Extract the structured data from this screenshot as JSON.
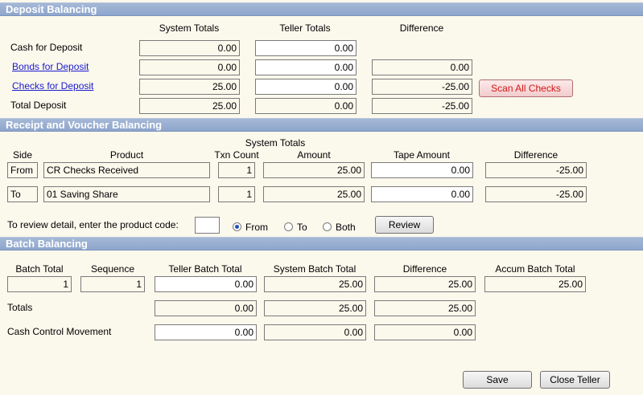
{
  "deposit": {
    "title": "Deposit Balancing",
    "headers": {
      "system": "System Totals",
      "teller": "Teller Totals",
      "diff": "Difference"
    },
    "rows": [
      {
        "label": "Cash for Deposit",
        "system": "0.00",
        "teller": "0.00",
        "diff": ""
      },
      {
        "label": "Bonds for Deposit",
        "system": "0.00",
        "teller": "0.00",
        "diff": "0.00"
      },
      {
        "label": "Checks for Deposit",
        "system": "25.00",
        "teller": "0.00",
        "diff": "-25.00"
      },
      {
        "label": "Total Deposit",
        "system": "25.00",
        "teller": "0.00",
        "diff": "-25.00"
      }
    ],
    "scan_button": "Scan All Checks"
  },
  "receipt": {
    "title": "Receipt and Voucher Balancing",
    "headers": {
      "system_totals": "System Totals",
      "side": "Side",
      "product": "Product",
      "txn_count": "Txn Count",
      "amount": "Amount",
      "tape_amount": "Tape Amount",
      "diff": "Difference"
    },
    "rows": [
      {
        "side": "From",
        "product": "CR Checks Received",
        "count": "1",
        "amount": "25.00",
        "tape": "0.00",
        "diff": "-25.00"
      },
      {
        "side": "To",
        "product": "01 Saving Share",
        "count": "1",
        "amount": "25.00",
        "tape": "0.00",
        "diff": "-25.00"
      }
    ],
    "review_prompt": "To review detail, enter the product code:",
    "product_code": "",
    "radio_from": "From",
    "radio_to": "To",
    "radio_both": "Both",
    "selected": "From",
    "review_button": "Review"
  },
  "batch": {
    "title": "Batch Balancing",
    "headers": {
      "batch_total": "Batch Total",
      "sequence": "Sequence",
      "teller_batch": "Teller Batch Total",
      "system_batch": "System Batch Total",
      "diff": "Difference",
      "accum": "Accum Batch Total"
    },
    "row": {
      "batch_total": "1",
      "sequence": "1",
      "teller_batch": "0.00",
      "system_batch": "25.00",
      "diff": "25.00",
      "accum": "25.00"
    },
    "totals_label": "Totals",
    "totals": {
      "teller_batch": "0.00",
      "system_batch": "25.00",
      "diff": "25.00"
    },
    "cash_label": "Cash Control Movement",
    "cash": {
      "teller_batch": "0.00",
      "system_batch": "0.00",
      "diff": "0.00"
    }
  },
  "footer": {
    "save": "Save",
    "close": "Close Teller"
  }
}
